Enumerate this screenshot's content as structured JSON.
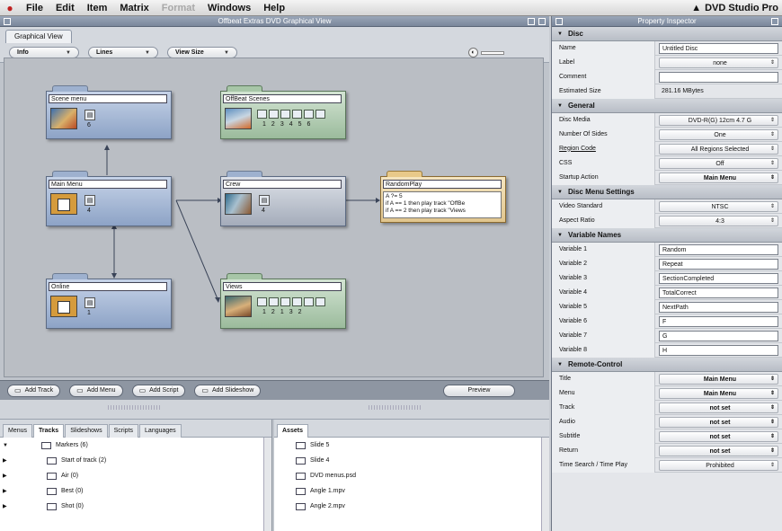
{
  "menubar": {
    "items": [
      "File",
      "Edit",
      "Item",
      "Matrix",
      "Format",
      "Windows",
      "Help"
    ],
    "dimmed": [
      4
    ],
    "app_name": "DVD Studio Pro"
  },
  "graphical_window": {
    "title": "Offbeat Extras DVD Graphical View",
    "tab_label": "Graphical View",
    "toolbar": {
      "info": "Info",
      "lines": "Lines",
      "view_size": "View Size"
    }
  },
  "nodes": {
    "scene_menu": {
      "title": "Scene menu",
      "buttons": "6"
    },
    "offbeat_scenes": {
      "title": "OffBeat Scenes",
      "frames": [
        "1",
        "2",
        "3",
        "4",
        "5",
        "6"
      ]
    },
    "main_menu": {
      "title": "Main Menu",
      "buttons": "4"
    },
    "crew": {
      "title": "Crew",
      "buttons": "4"
    },
    "random_play": {
      "title": "RandomPlay",
      "code": [
        "A ?= 5",
        "if A == 1 then play track \"OffBe",
        "if A == 2 then play track \"Views"
      ]
    },
    "online": {
      "title": "Online",
      "buttons": "1"
    },
    "views": {
      "title": "Views",
      "frames": [
        "1",
        "2",
        "1",
        "3",
        "2"
      ]
    }
  },
  "add_bar": {
    "add_track": "Add Track",
    "add_menu": "Add Menu",
    "add_script": "Add Script",
    "add_slideshow": "Add Slideshow",
    "preview": "Preview"
  },
  "project_tabs": {
    "tabs": [
      "Menus",
      "Tracks",
      "Slideshows",
      "Scripts",
      "Languages"
    ],
    "active": "Tracks",
    "rows": [
      {
        "label": "Markers (6)",
        "indent": 1
      },
      {
        "label": "Start of track (2)",
        "indent": 2
      },
      {
        "label": "Air (0)",
        "indent": 2
      },
      {
        "label": "Best (0)",
        "indent": 2
      },
      {
        "label": "Shot (0)",
        "indent": 2
      }
    ]
  },
  "assets": {
    "tab": "Assets",
    "rows": [
      "Slide 5",
      "Slide 4",
      "DVD menus.psd",
      "Angle 1.mpv",
      "Angle 2.mpv"
    ]
  },
  "inspector": {
    "title": "Property Inspector",
    "sections": [
      {
        "name": "Disc",
        "rows": [
          {
            "label": "Name",
            "value": "Untitled Disc",
            "kind": "text"
          },
          {
            "label": "Label",
            "value": "none",
            "kind": "pop"
          },
          {
            "label": "Comment",
            "value": "",
            "kind": "text"
          },
          {
            "label": "Estimated Size",
            "value": "281.16 MBytes",
            "kind": "plain"
          }
        ]
      },
      {
        "name": "General",
        "rows": [
          {
            "label": "Disc Media",
            "value": "DVD-R(G) 12cm 4.7 G",
            "kind": "pop"
          },
          {
            "label": "Number Of Sides",
            "value": "One",
            "kind": "pop"
          },
          {
            "label": "Region Code",
            "value": "All Regions Selected",
            "kind": "pop",
            "underline": true
          },
          {
            "label": "CSS",
            "value": "Off",
            "kind": "pop"
          },
          {
            "label": "Startup Action",
            "value": "Main Menu",
            "kind": "popb"
          }
        ]
      },
      {
        "name": "Disc Menu Settings",
        "rows": [
          {
            "label": "Video Standard",
            "value": "NTSC",
            "kind": "pop"
          },
          {
            "label": "Aspect Ratio",
            "value": "4:3",
            "kind": "pop"
          }
        ]
      },
      {
        "name": "Variable Names",
        "rows": [
          {
            "label": "Variable 1",
            "value": "Random",
            "kind": "text"
          },
          {
            "label": "Variable 2",
            "value": "Repeat",
            "kind": "text"
          },
          {
            "label": "Variable 3",
            "value": "SectionCompleted",
            "kind": "text"
          },
          {
            "label": "Variable 4",
            "value": "TotalCorrect",
            "kind": "text"
          },
          {
            "label": "Variable 5",
            "value": "NextPath",
            "kind": "text"
          },
          {
            "label": "Variable 6",
            "value": "F",
            "kind": "text"
          },
          {
            "label": "Variable 7",
            "value": "G",
            "kind": "text"
          },
          {
            "label": "Variable 8",
            "value": "H",
            "kind": "text"
          }
        ]
      },
      {
        "name": "Remote-Control",
        "rows": [
          {
            "label": "Title",
            "value": "Main Menu",
            "kind": "popb"
          },
          {
            "label": "Menu",
            "value": "Main Menu",
            "kind": "popb"
          },
          {
            "label": "Track",
            "value": "not set",
            "kind": "popb"
          },
          {
            "label": "Audio",
            "value": "not set",
            "kind": "popb"
          },
          {
            "label": "Subtitle",
            "value": "not set",
            "kind": "popb"
          },
          {
            "label": "Return",
            "value": "not set",
            "kind": "popb"
          },
          {
            "label": "Time Search / Time Play",
            "value": "Prohibited",
            "kind": "pop"
          }
        ]
      }
    ]
  }
}
